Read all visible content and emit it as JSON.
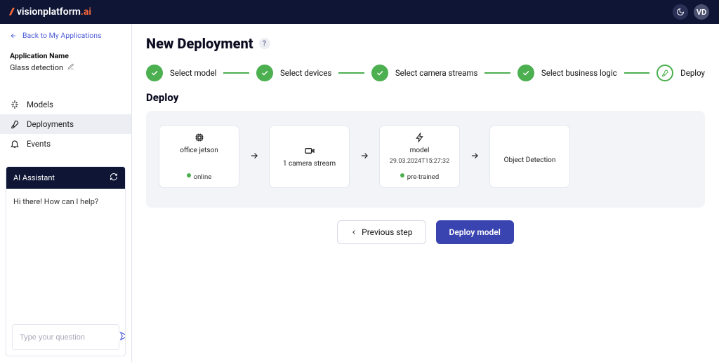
{
  "brand": {
    "name": "visionplatform",
    "suffix": ".ai"
  },
  "topbar": {
    "avatar_initials": "VD"
  },
  "sidebar": {
    "back_label": "Back to My Applications",
    "app_name_label": "Application Name",
    "app_name_value": "Glass detection",
    "nav": [
      {
        "key": "models",
        "label": "Models",
        "active": false
      },
      {
        "key": "deployments",
        "label": "Deployments",
        "active": true
      },
      {
        "key": "events",
        "label": "Events",
        "active": false
      }
    ]
  },
  "assistant": {
    "title": "AI Assistant",
    "greeting": "Hi there! How can I help?",
    "placeholder": "Type your question"
  },
  "page": {
    "title": "New Deployment",
    "section_title": "Deploy"
  },
  "stepper": [
    {
      "label": "Select model",
      "state": "done"
    },
    {
      "label": "Select devices",
      "state": "done"
    },
    {
      "label": "Select camera streams",
      "state": "done"
    },
    {
      "label": "Select business logic",
      "state": "done"
    },
    {
      "label": "Deploy",
      "state": "current"
    }
  ],
  "deploy_cards": {
    "device": {
      "title": "office jetson",
      "status": "online"
    },
    "stream": {
      "title": "1 camera stream"
    },
    "model": {
      "title": "model",
      "subtitle": "29.03.2024T15:27:32",
      "status": "pre-trained"
    },
    "logic": {
      "title": "Object Detection"
    }
  },
  "buttons": {
    "prev": "Previous step",
    "deploy": "Deploy model"
  },
  "colors": {
    "brand_orange": "#ff6a3c",
    "accent_green": "#4caf50",
    "primary_blue": "#3a44b0",
    "navy": "#0f1635"
  }
}
